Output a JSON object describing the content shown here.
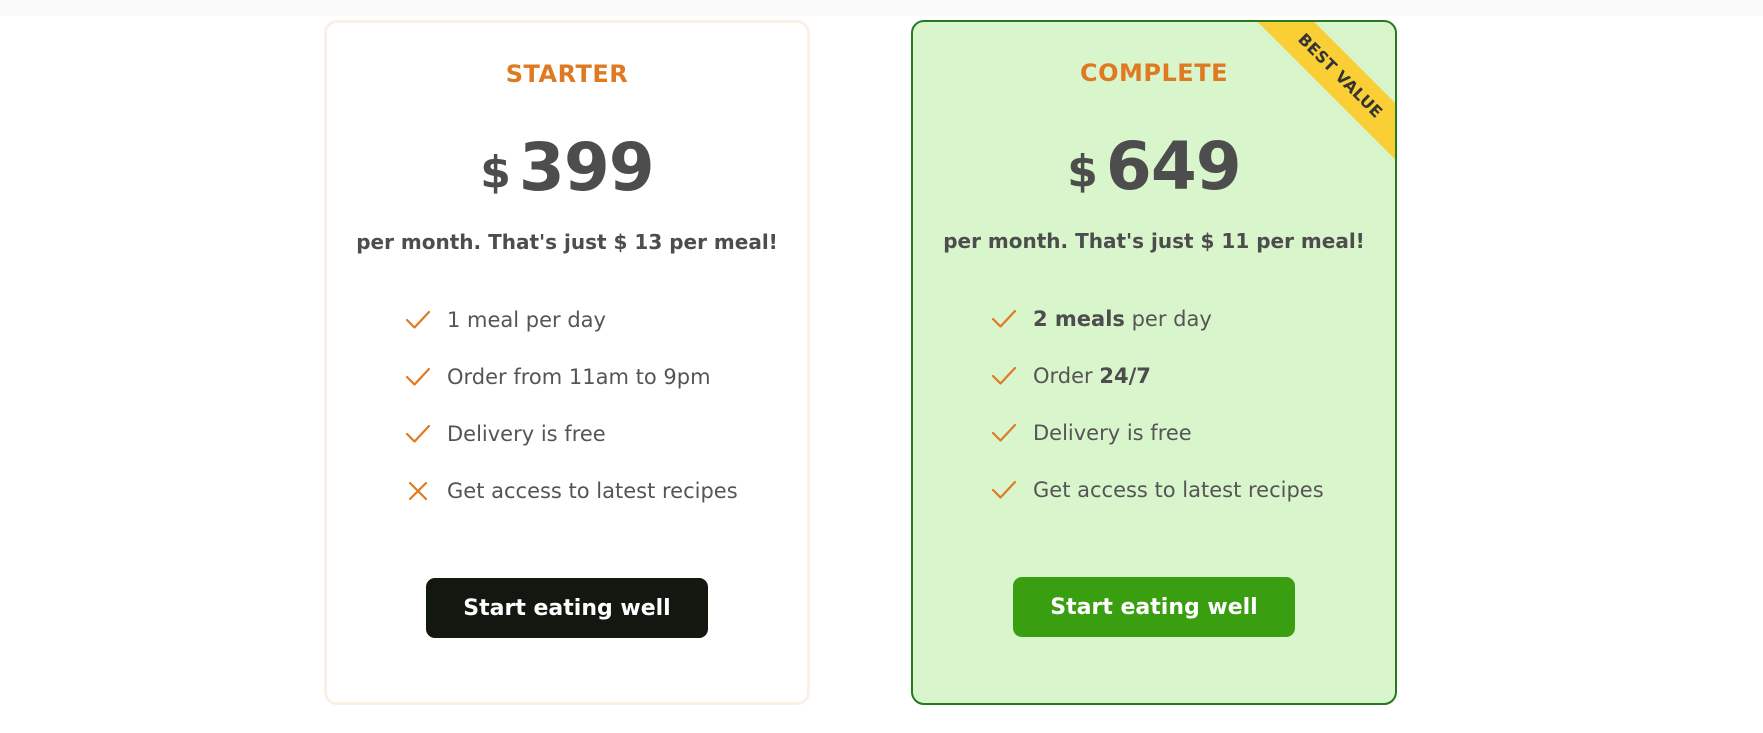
{
  "plans": [
    {
      "name": "Starter",
      "currency": "$",
      "price": "399",
      "per_meal_text": "per month. That's just $ 13 per meal!",
      "features": [
        {
          "icon": "check-icon",
          "parts": [
            {
              "text": "1 meal per day",
              "bold": false
            }
          ]
        },
        {
          "icon": "check-icon",
          "parts": [
            {
              "text": "Order from 11am to 9pm",
              "bold": false
            }
          ]
        },
        {
          "icon": "check-icon",
          "parts": [
            {
              "text": "Delivery is free",
              "bold": false
            }
          ]
        },
        {
          "icon": "close-icon",
          "parts": [
            {
              "text": "Get access to latest recipes",
              "bold": false
            }
          ]
        }
      ],
      "cta_label": "Start eating well"
    },
    {
      "name": "Complete",
      "currency": "$",
      "price": "649",
      "per_meal_text": "per month. That's just $ 11 per meal!",
      "ribbon": "Best value",
      "features": [
        {
          "icon": "check-icon",
          "parts": [
            {
              "text": "2 meals",
              "bold": true
            },
            {
              "text": " per day",
              "bold": false
            }
          ]
        },
        {
          "icon": "check-icon",
          "parts": [
            {
              "text": "Order ",
              "bold": false
            },
            {
              "text": "24/7",
              "bold": true
            }
          ]
        },
        {
          "icon": "check-icon",
          "parts": [
            {
              "text": "Delivery is free",
              "bold": false
            }
          ]
        },
        {
          "icon": "check-icon",
          "parts": [
            {
              "text": "Get access to latest recipes",
              "bold": false
            }
          ]
        }
      ],
      "cta_label": "Start eating well"
    }
  ],
  "colors": {
    "accent": "#e07a22",
    "best_value_ribbon": "#f9cf35",
    "complete_card_bg": "#d9f5cc",
    "complete_border": "#237a1f",
    "starter_button": "#121810",
    "complete_button": "#3a9f10"
  }
}
